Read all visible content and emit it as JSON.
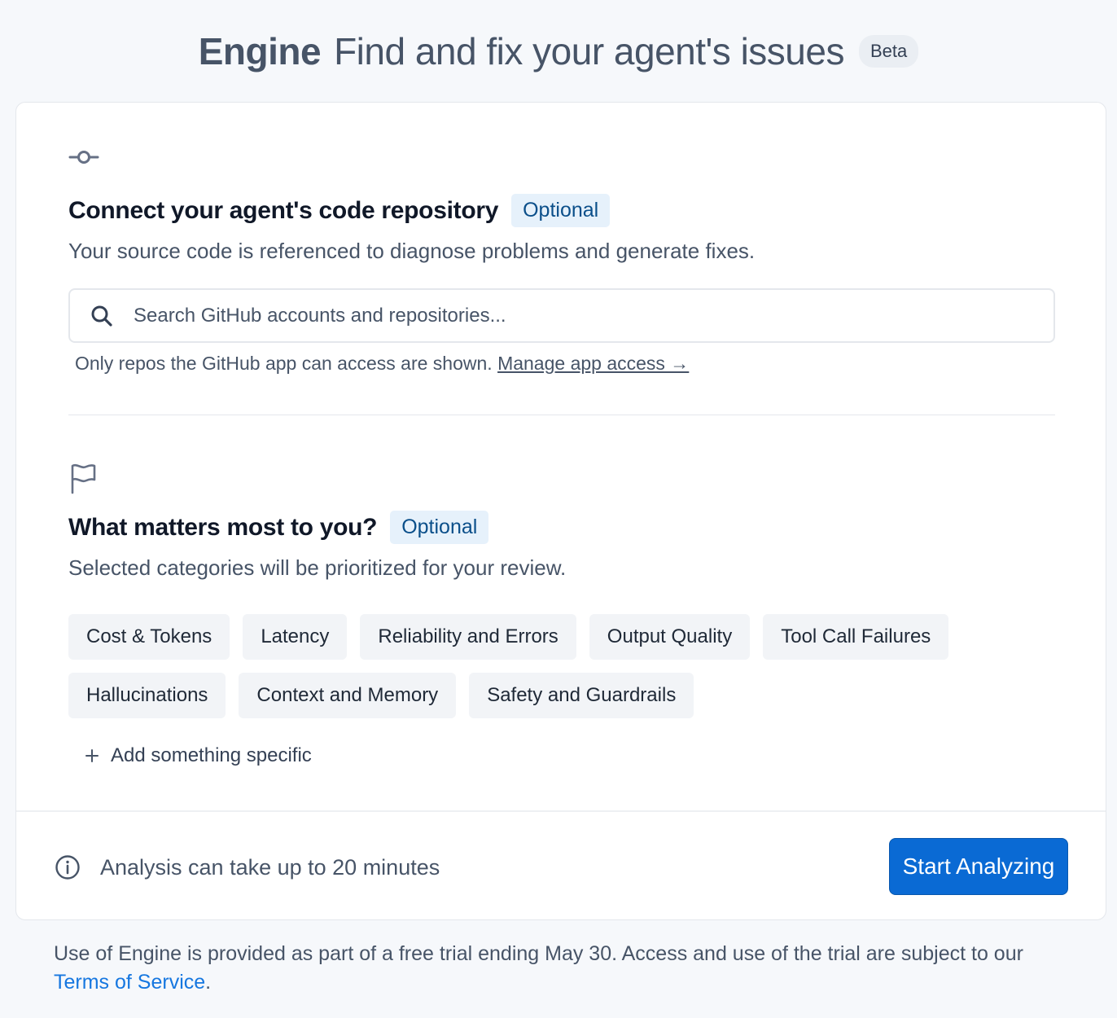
{
  "header": {
    "brand": "Engine",
    "tagline": "Find and fix your agent's issues",
    "badge": "Beta"
  },
  "repo_section": {
    "icon": "commit-icon",
    "title": "Connect your agent's code repository",
    "badge": "Optional",
    "description": "Your source code is referenced to diagnose problems and generate fixes.",
    "search_placeholder": "Search GitHub accounts and repositories...",
    "hint": "Only repos the GitHub app can access are shown.",
    "manage_link": "Manage app access →"
  },
  "priorities_section": {
    "icon": "flag-icon",
    "title": "What matters most to you?",
    "badge": "Optional",
    "description": "Selected categories will be prioritized for your review.",
    "categories": [
      "Cost & Tokens",
      "Latency",
      "Reliability and Errors",
      "Output Quality",
      "Tool Call Failures",
      "Hallucinations",
      "Context and Memory",
      "Safety and Guardrails"
    ],
    "add_label": "Add something specific"
  },
  "footer": {
    "note": "Analysis can take up to 20 minutes",
    "button": "Start Analyzing"
  },
  "legal": {
    "text": "Use of Engine is provided as part of a free trial ending May 30. Access and use of the trial are subject to our",
    "link": "Terms of Service",
    "end": "."
  },
  "colors": {
    "accent": "#0a6ad4",
    "badge_bg": "#e6f1fb",
    "link": "#1677e0"
  }
}
